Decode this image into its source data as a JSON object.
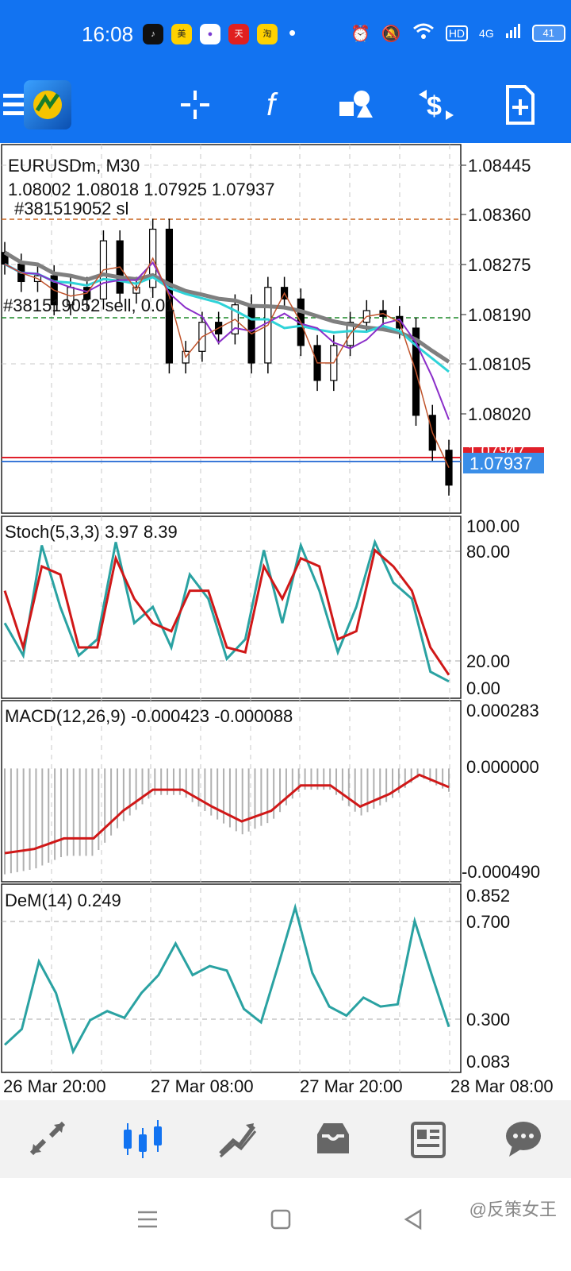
{
  "status_bar": {
    "time": "16:08",
    "apps": [
      "TikTok",
      "美团",
      "App",
      "天猫",
      "淘宝"
    ],
    "network": "4G",
    "hd_label": "HD",
    "battery": "41"
  },
  "toolbar": {
    "icons": [
      "menu-icon",
      "app-logo",
      "crosshair-icon",
      "function-icon",
      "objects-icon",
      "trade-icon",
      "new-order-icon"
    ]
  },
  "chart": {
    "symbol_label": "EURUSDm, M30",
    "ohlc_label": "1.08002 1.08018 1.07925 1.07937",
    "sl_order_label": "#381519052 sl",
    "sell_order_label": "#381519052 sell, 0.01",
    "price_axis": [
      "1.08445",
      "1.08360",
      "1.08275",
      "1.08190",
      "1.08105",
      "1.08020"
    ],
    "current_price": "1.07937",
    "ask_price_partial": "1.07947",
    "time_axis": [
      "26 Mar 20:00",
      "27 Mar 08:00",
      "27 Mar 20:00",
      "28 Mar 08:00"
    ],
    "colors": {
      "bull_bear_candle": "#000000",
      "ma_fast": "#c0542c",
      "ma_mid": "#8b2fc9",
      "ma_slow": "#2fd3d8",
      "ma_long": "#7f7f7f",
      "sl_line": "#c8641e",
      "sell_line": "#1f8a2a",
      "bid_line": "#e0202a",
      "ask_line": "#3a78d8"
    }
  },
  "stoch": {
    "label": "Stoch(5,3,3) 3.97 8.39",
    "axis": [
      "100.00",
      "80.00",
      "20.00",
      "0.00"
    ],
    "colors": {
      "main": "#2aa2a2",
      "signal": "#d01818"
    }
  },
  "macd": {
    "label": "MACD(12,26,9) -0.000423 -0.000088",
    "axis": [
      "0.000283",
      "0.000000",
      "-0.000490"
    ],
    "colors": {
      "histogram": "#b0b0b0",
      "signal": "#d01818"
    }
  },
  "dem": {
    "label": "DeM(14) 0.249",
    "axis": [
      "0.852",
      "0.700",
      "0.300",
      "0.083"
    ],
    "colors": {
      "line": "#2aa2a2"
    }
  },
  "bottom_nav": {
    "items": [
      "quotes-icon",
      "chart-icon",
      "trade-icon",
      "history-icon",
      "news-icon",
      "chat-icon"
    ],
    "active_color": "#1273f1",
    "inactive_color": "#666666"
  },
  "system_nav": {
    "watermark": "@反策女王"
  },
  "chart_data": [
    {
      "type": "line",
      "title": "EURUSDm, M30",
      "ohlc_current": [
        1.08002,
        1.08018,
        1.07925,
        1.07937
      ],
      "ylim": [
        1.079,
        1.0852
      ],
      "xlabel": "",
      "ylabel": "",
      "x": [
        "26 Mar 20:00",
        "27 Mar 08:00",
        "27 Mar 20:00",
        "28 Mar 08:00"
      ],
      "series": [
        {
          "name": "",
          "values": [
            1.0832,
            1.0829,
            1.083,
            1.0825,
            1.0828,
            1.0826,
            1.0836,
            1.0827,
            1.0828,
            1.0838,
            1.0815,
            1.0817,
            1.0822,
            1.082,
            1.0825,
            1.0815,
            1.0828,
            1.0826,
            1.0818,
            1.0812,
            1.0818,
            1.0822,
            1.0824,
            1.0823,
            1.0821,
            1.0806,
            1.08,
            1.0794
          ]
        }
      ],
      "horizontal_lines": [
        1.0836,
        1.0819,
        1.07947,
        1.07937
      ]
    },
    {
      "type": "line",
      "title": "Stoch(5,3,3) 3.97 8.39",
      "ylim": [
        0,
        100
      ],
      "series": [
        {
          "name": "",
          "values": [
            40,
            20,
            88,
            50,
            20,
            30,
            90,
            40,
            50,
            25,
            70,
            55,
            18,
            30,
            85,
            40,
            88,
            60,
            22,
            50,
            90,
            65,
            55,
            10,
            4
          ]
        },
        {
          "name": "",
          "values": [
            60,
            25,
            75,
            70,
            25,
            25,
            80,
            55,
            40,
            35,
            60,
            60,
            25,
            22,
            75,
            55,
            80,
            75,
            30,
            35,
            85,
            75,
            60,
            25,
            8
          ]
        }
      ]
    },
    {
      "type": "line",
      "title": "MACD(12,26,9) -0.000423 -0.000088",
      "ylim": [
        -0.00049,
        0.000283
      ],
      "series": [
        {
          "name": "",
          "values": [
            -0.0004,
            -0.00038,
            -0.00033,
            -0.00033,
            -0.0002,
            -0.0001,
            -0.0001,
            -0.00018,
            -0.00025,
            -0.0002,
            -8e-05,
            -8e-05,
            -0.00018,
            -0.00012,
            -3e-05,
            -8.8e-05
          ]
        }
      ]
    },
    {
      "type": "line",
      "title": "DeM(14) 0.249",
      "ylim": [
        0.083,
        0.852
      ],
      "series": [
        {
          "name": "",
          "values": [
            0.17,
            0.24,
            0.54,
            0.4,
            0.14,
            0.28,
            0.32,
            0.29,
            0.4,
            0.48,
            0.62,
            0.48,
            0.52,
            0.5,
            0.33,
            0.27,
            0.52,
            0.78,
            0.49,
            0.34,
            0.3,
            0.38,
            0.34,
            0.35,
            0.72,
            0.48,
            0.25
          ]
        }
      ]
    }
  ]
}
